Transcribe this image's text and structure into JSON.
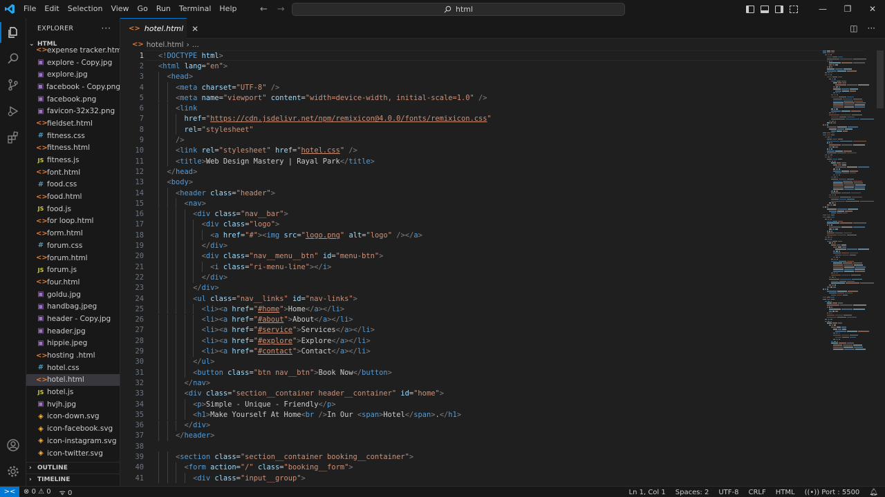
{
  "menu": [
    "File",
    "Edit",
    "Selection",
    "View",
    "Go",
    "Run",
    "Terminal",
    "Help"
  ],
  "search": {
    "text": "html"
  },
  "sidebar": {
    "title": "EXPLORER",
    "folder": "HTML",
    "files": [
      {
        "name": "expense tracker.html",
        "type": "html"
      },
      {
        "name": "explore - Copy.jpg",
        "type": "img"
      },
      {
        "name": "explore.jpg",
        "type": "img"
      },
      {
        "name": "facebook - Copy.png",
        "type": "img"
      },
      {
        "name": "facebook.png",
        "type": "img"
      },
      {
        "name": "favicon-32x32.png",
        "type": "img"
      },
      {
        "name": "fieldset.html",
        "type": "html"
      },
      {
        "name": "fitness.css",
        "type": "css"
      },
      {
        "name": "fitness.html",
        "type": "html"
      },
      {
        "name": "fitness.js",
        "type": "js"
      },
      {
        "name": "font.html",
        "type": "html"
      },
      {
        "name": "food.css",
        "type": "css"
      },
      {
        "name": "food.html",
        "type": "html"
      },
      {
        "name": "food.js",
        "type": "js"
      },
      {
        "name": "for loop.html",
        "type": "html"
      },
      {
        "name": "form.html",
        "type": "html"
      },
      {
        "name": "forum.css",
        "type": "css"
      },
      {
        "name": "forum.html",
        "type": "html"
      },
      {
        "name": "forum.js",
        "type": "js"
      },
      {
        "name": "four.html",
        "type": "html"
      },
      {
        "name": "goldu.jpg",
        "type": "img"
      },
      {
        "name": "handbag.jpeg",
        "type": "img"
      },
      {
        "name": "header - Copy.jpg",
        "type": "img"
      },
      {
        "name": "header.jpg",
        "type": "img"
      },
      {
        "name": "hippie.jpeg",
        "type": "img"
      },
      {
        "name": "hosting .html",
        "type": "html"
      },
      {
        "name": "hotel.css",
        "type": "css"
      },
      {
        "name": "hotel.html",
        "type": "html",
        "selected": true
      },
      {
        "name": "hotel.js",
        "type": "js"
      },
      {
        "name": "hvjh.jpg",
        "type": "img"
      },
      {
        "name": "icon-down.svg",
        "type": "svg"
      },
      {
        "name": "icon-facebook.svg",
        "type": "svg"
      },
      {
        "name": "icon-instagram.svg",
        "type": "svg"
      },
      {
        "name": "icon-twitter.svg",
        "type": "svg"
      }
    ],
    "outline": "OUTLINE",
    "timeline": "TIMELINE"
  },
  "tab": {
    "name": "hotel.html"
  },
  "breadcrumb": {
    "file": "hotel.html",
    "more": "..."
  },
  "code": [
    {
      "n": "1",
      "i": 0,
      "h": "<span class='p'>&lt;!</span><span class='t'>DOCTYPE</span> <span class='a'>html</span><span class='p'>&gt;</span>"
    },
    {
      "n": "2",
      "i": 0,
      "h": "<span class='p'>&lt;</span><span class='t'>html</span> <span class='a'>lang</span>=<span class='s'>\"en\"</span><span class='p'>&gt;</span>"
    },
    {
      "n": "3",
      "i": 1,
      "h": "<span class='p'>&lt;</span><span class='t'>head</span><span class='p'>&gt;</span>"
    },
    {
      "n": "4",
      "i": 2,
      "h": "<span class='p'>&lt;</span><span class='t'>meta</span> <span class='a'>charset</span>=<span class='s'>\"UTF-8\"</span> <span class='p'>/&gt;</span>"
    },
    {
      "n": "5",
      "i": 2,
      "h": "<span class='p'>&lt;</span><span class='t'>meta</span> <span class='a'>name</span>=<span class='s'>\"viewport\"</span> <span class='a'>content</span>=<span class='s'>\"width=device-width, initial-scale=1.0\"</span> <span class='p'>/&gt;</span>"
    },
    {
      "n": "6",
      "i": 2,
      "h": "<span class='p'>&lt;</span><span class='t'>link</span>"
    },
    {
      "n": "7",
      "i": 3,
      "h": "<span class='a'>href</span>=<span class='s'>\"</span><span class='u'>https://cdn.jsdelivr.net/npm/remixicon@4.0.0/fonts/remixicon.css</span><span class='s'>\"</span>"
    },
    {
      "n": "8",
      "i": 3,
      "h": "<span class='a'>rel</span>=<span class='s'>\"stylesheet\"</span>"
    },
    {
      "n": "9",
      "i": 2,
      "h": "<span class='p'>/&gt;</span>"
    },
    {
      "n": "10",
      "i": 2,
      "h": "<span class='p'>&lt;</span><span class='t'>link</span> <span class='a'>rel</span>=<span class='s'>\"stylesheet\"</span> <span class='a'>href</span>=<span class='s'>\"</span><span class='u'>hotel.css</span><span class='s'>\"</span> <span class='p'>/&gt;</span>"
    },
    {
      "n": "11",
      "i": 2,
      "h": "<span class='p'>&lt;</span><span class='t'>title</span><span class='p'>&gt;</span>Web Design Mastery | Rayal Park<span class='p'>&lt;/</span><span class='t'>title</span><span class='p'>&gt;</span>"
    },
    {
      "n": "12",
      "i": 1,
      "h": "<span class='p'>&lt;/</span><span class='t'>head</span><span class='p'>&gt;</span>"
    },
    {
      "n": "13",
      "i": 1,
      "h": "<span class='p'>&lt;</span><span class='t'>body</span><span class='p'>&gt;</span>"
    },
    {
      "n": "14",
      "i": 2,
      "h": "<span class='p'>&lt;</span><span class='t'>header</span> <span class='a'>class</span>=<span class='s'>\"header\"</span><span class='p'>&gt;</span>"
    },
    {
      "n": "15",
      "i": 3,
      "h": "<span class='p'>&lt;</span><span class='t'>nav</span><span class='p'>&gt;</span>"
    },
    {
      "n": "16",
      "i": 4,
      "h": "<span class='p'>&lt;</span><span class='t'>div</span> <span class='a'>class</span>=<span class='s'>\"nav__bar\"</span><span class='p'>&gt;</span>"
    },
    {
      "n": "17",
      "i": 5,
      "h": "<span class='p'>&lt;</span><span class='t'>div</span> <span class='a'>class</span>=<span class='s'>\"logo\"</span><span class='p'>&gt;</span>"
    },
    {
      "n": "18",
      "i": 6,
      "h": "<span class='p'>&lt;</span><span class='t'>a</span> <span class='a'>href</span>=<span class='s'>\"#\"</span><span class='p'>&gt;&lt;</span><span class='t'>img</span> <span class='a'>src</span>=<span class='s'>\"</span><span class='u'>logo.png</span><span class='s'>\"</span> <span class='a'>alt</span>=<span class='s'>\"logo\"</span> <span class='p'>/&gt;&lt;/</span><span class='t'>a</span><span class='p'>&gt;</span>"
    },
    {
      "n": "19",
      "i": 5,
      "h": "<span class='p'>&lt;/</span><span class='t'>div</span><span class='p'>&gt;</span>"
    },
    {
      "n": "20",
      "i": 5,
      "h": "<span class='p'>&lt;</span><span class='t'>div</span> <span class='a'>class</span>=<span class='s'>\"nav__menu__btn\"</span> <span class='a'>id</span>=<span class='s'>\"menu-btn\"</span><span class='p'>&gt;</span>"
    },
    {
      "n": "21",
      "i": 6,
      "h": "<span class='p'>&lt;</span><span class='t'>i</span> <span class='a'>class</span>=<span class='s'>\"ri-menu-line\"</span><span class='p'>&gt;&lt;/</span><span class='t'>i</span><span class='p'>&gt;</span>"
    },
    {
      "n": "22",
      "i": 5,
      "h": "<span class='p'>&lt;/</span><span class='t'>div</span><span class='p'>&gt;</span>"
    },
    {
      "n": "23",
      "i": 4,
      "h": "<span class='p'>&lt;/</span><span class='t'>div</span><span class='p'>&gt;</span>"
    },
    {
      "n": "24",
      "i": 4,
      "h": "<span class='p'>&lt;</span><span class='t'>ul</span> <span class='a'>class</span>=<span class='s'>\"nav__links\"</span> <span class='a'>id</span>=<span class='s'>\"nav-links\"</span><span class='p'>&gt;</span>"
    },
    {
      "n": "25",
      "i": 5,
      "h": "<span class='p'>&lt;</span><span class='t'>li</span><span class='p'>&gt;&lt;</span><span class='t'>a</span> <span class='a'>href</span>=<span class='s'>\"</span><span class='u'>#home</span><span class='s'>\"</span><span class='p'>&gt;</span>Home<span class='p'>&lt;/</span><span class='t'>a</span><span class='p'>&gt;&lt;/</span><span class='t'>li</span><span class='p'>&gt;</span>"
    },
    {
      "n": "26",
      "i": 5,
      "h": "<span class='p'>&lt;</span><span class='t'>li</span><span class='p'>&gt;&lt;</span><span class='t'>a</span> <span class='a'>href</span>=<span class='s'>\"</span><span class='u'>#about</span><span class='s'>\"</span><span class='p'>&gt;</span>About<span class='p'>&lt;/</span><span class='t'>a</span><span class='p'>&gt;&lt;/</span><span class='t'>li</span><span class='p'>&gt;</span>"
    },
    {
      "n": "27",
      "i": 5,
      "h": "<span class='p'>&lt;</span><span class='t'>li</span><span class='p'>&gt;&lt;</span><span class='t'>a</span> <span class='a'>href</span>=<span class='s'>\"</span><span class='u'>#service</span><span class='s'>\"</span><span class='p'>&gt;</span>Services<span class='p'>&lt;/</span><span class='t'>a</span><span class='p'>&gt;&lt;/</span><span class='t'>li</span><span class='p'>&gt;</span>"
    },
    {
      "n": "28",
      "i": 5,
      "h": "<span class='p'>&lt;</span><span class='t'>li</span><span class='p'>&gt;&lt;</span><span class='t'>a</span> <span class='a'>href</span>=<span class='s'>\"</span><span class='u'>#explore</span><span class='s'>\"</span><span class='p'>&gt;</span>Explore<span class='p'>&lt;/</span><span class='t'>a</span><span class='p'>&gt;&lt;/</span><span class='t'>li</span><span class='p'>&gt;</span>"
    },
    {
      "n": "29",
      "i": 5,
      "h": "<span class='p'>&lt;</span><span class='t'>li</span><span class='p'>&gt;&lt;</span><span class='t'>a</span> <span class='a'>href</span>=<span class='s'>\"</span><span class='u'>#contact</span><span class='s'>\"</span><span class='p'>&gt;</span>Contact<span class='p'>&lt;/</span><span class='t'>a</span><span class='p'>&gt;&lt;/</span><span class='t'>li</span><span class='p'>&gt;</span>"
    },
    {
      "n": "30",
      "i": 4,
      "h": "<span class='p'>&lt;/</span><span class='t'>ul</span><span class='p'>&gt;</span>"
    },
    {
      "n": "31",
      "i": 4,
      "h": "<span class='p'>&lt;</span><span class='t'>button</span> <span class='a'>class</span>=<span class='s'>\"btn nav__btn\"</span><span class='p'>&gt;</span>Book Now<span class='p'>&lt;/</span><span class='t'>button</span><span class='p'>&gt;</span>"
    },
    {
      "n": "32",
      "i": 3,
      "h": "<span class='p'>&lt;/</span><span class='t'>nav</span><span class='p'>&gt;</span>"
    },
    {
      "n": "33",
      "i": 3,
      "h": "<span class='p'>&lt;</span><span class='t'>div</span> <span class='a'>class</span>=<span class='s'>\"section__container header__container\"</span> <span class='a'>id</span>=<span class='s'>\"home\"</span><span class='p'>&gt;</span>"
    },
    {
      "n": "34",
      "i": 4,
      "h": "<span class='p'>&lt;</span><span class='t'>p</span><span class='p'>&gt;</span>Simple - Unique - Friendly<span class='p'>&lt;/</span><span class='t'>p</span><span class='p'>&gt;</span>"
    },
    {
      "n": "35",
      "i": 4,
      "h": "<span class='p'>&lt;</span><span class='t'>h1</span><span class='p'>&gt;</span>Make Yourself At Home<span class='p'>&lt;</span><span class='t'>br</span> <span class='p'>/&gt;</span>In Our <span class='p'>&lt;</span><span class='t'>span</span><span class='p'>&gt;</span>Hotel<span class='p'>&lt;/</span><span class='t'>span</span><span class='p'>&gt;</span>.<span class='p'>&lt;/</span><span class='t'>h1</span><span class='p'>&gt;</span>"
    },
    {
      "n": "36",
      "i": 3,
      "h": "<span class='p'>&lt;/</span><span class='t'>div</span><span class='p'>&gt;</span>"
    },
    {
      "n": "37",
      "i": 2,
      "h": "<span class='p'>&lt;/</span><span class='t'>header</span><span class='p'>&gt;</span>"
    },
    {
      "n": "38",
      "i": 0,
      "h": ""
    },
    {
      "n": "39",
      "i": 2,
      "h": "<span class='p'>&lt;</span><span class='t'>section</span> <span class='a'>class</span>=<span class='s'>\"section__container booking__container\"</span><span class='p'>&gt;</span>"
    },
    {
      "n": "40",
      "i": 3,
      "h": "<span class='p'>&lt;</span><span class='t'>form</span> <span class='a'>action</span>=<span class='s'>\"/\"</span> <span class='a'>class</span>=<span class='s'>\"booking__form\"</span><span class='p'>&gt;</span>"
    },
    {
      "n": "41",
      "i": 4,
      "h": "<span class='p'>&lt;</span><span class='t'>div</span> <span class='a'>class</span>=<span class='s'>\"input__group\"</span><span class='p'>&gt;</span>"
    }
  ],
  "status": {
    "errors": "0",
    "warnings": "0",
    "ports": "0",
    "position": "Ln 1, Col 1",
    "spaces": "Spaces: 2",
    "encoding": "UTF-8",
    "eol": "CRLF",
    "language": "HTML",
    "port": "Port : 5500"
  },
  "colors": {
    "accent": "#0078d4",
    "background": "#1f1f1f",
    "sidebar": "#181818"
  }
}
